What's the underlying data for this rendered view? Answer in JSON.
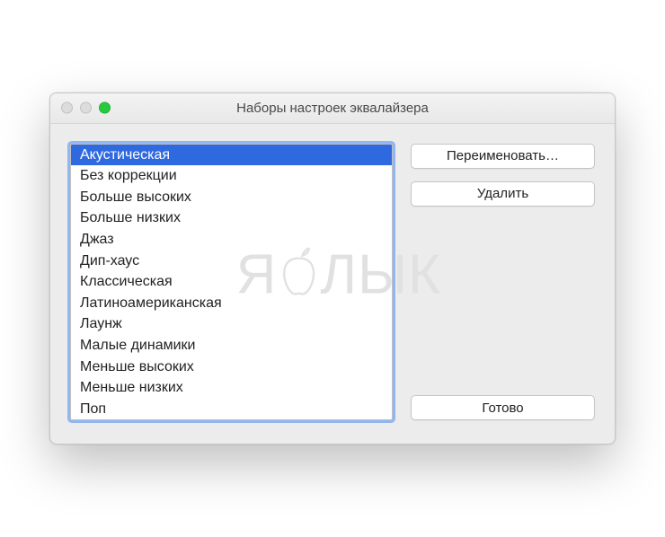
{
  "window": {
    "title": "Наборы настроек эквалайзера"
  },
  "presets": {
    "selected_index": 0,
    "items": [
      "Акустическая",
      "Без коррекции",
      "Больше высоких",
      "Больше низких",
      "Джаз",
      "Дип-хаус",
      "Классическая",
      "Латиноамериканская",
      "Лаунж",
      "Малые динамики",
      "Меньше высоких",
      "Меньше низких",
      "Поп"
    ]
  },
  "buttons": {
    "rename": "Переименовать…",
    "delete": "Удалить",
    "done": "Готово"
  },
  "watermark": {
    "left": "Я",
    "right": "ЛЫК"
  }
}
